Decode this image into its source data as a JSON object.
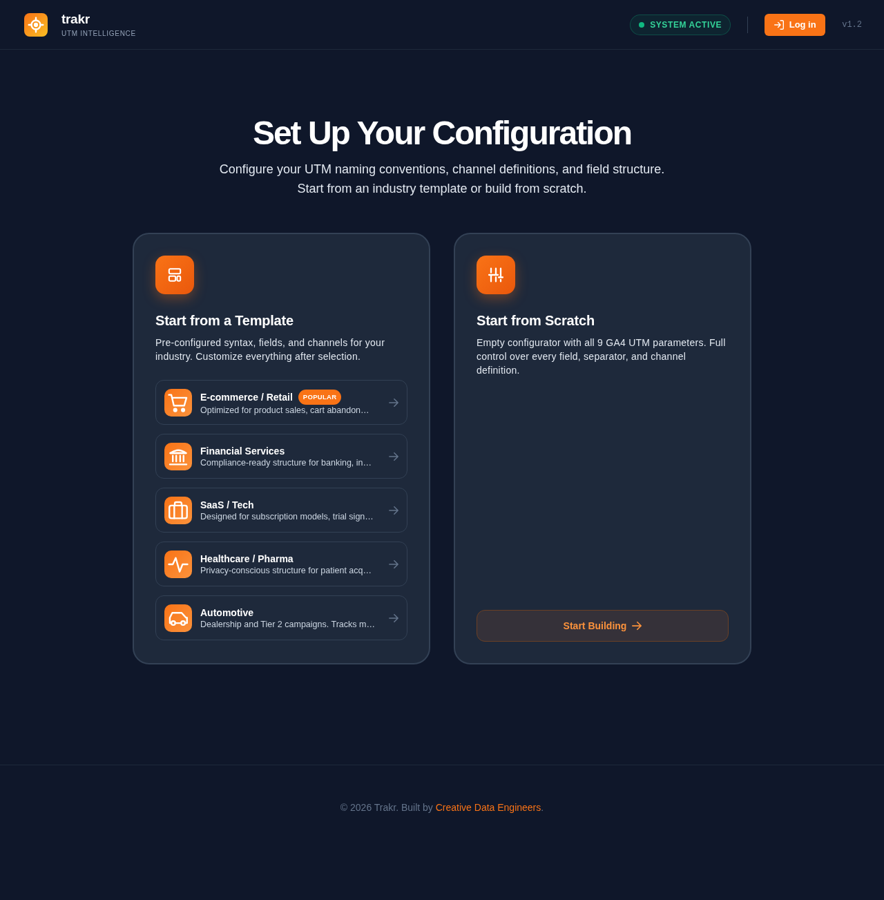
{
  "header": {
    "brand": {
      "name": "trakr",
      "tagline": "UTM INTELLIGENCE"
    },
    "status": {
      "label": "SYSTEM ACTIVE"
    },
    "login_button": "Log in",
    "version": "v1.2"
  },
  "hero": {
    "title": "Set Up Your Configuration",
    "subtitle_lines": [
      "Configure your UTM naming conventions, channel definitions, and field structure.",
      "Start from an industry template or build from scratch."
    ]
  },
  "options": [
    {
      "kind": "template",
      "title": "Start from a Template",
      "description": "Pre-configured syntax, fields, and channels for your industry. Customize everything after selection.",
      "templates": [
        {
          "title": "E-commerce / Retail",
          "badge": "POPULAR",
          "description": "Optimized for product sales, cart abandon…"
        },
        {
          "title": "Financial Services",
          "description": "Compliance-ready structure for banking, in…"
        },
        {
          "title": "SaaS / Tech",
          "description": "Designed for subscription models, trial sign…"
        },
        {
          "title": "Healthcare / Pharma",
          "description": "Privacy-conscious structure for patient acq…"
        },
        {
          "title": "Automotive",
          "description": "Dealership and Tier 2 campaigns. Tracks m…"
        }
      ]
    },
    {
      "kind": "scratch",
      "title": "Start from Scratch",
      "description": "Empty configurator with all 9 GA4 UTM parameters. Full control over every field, separator, and channel definition.",
      "button": "Start Building"
    }
  ],
  "footer": {
    "text_before": "© 2026 Trakr. Built by ",
    "link": "Creative Data Engineers",
    "text_after": "."
  }
}
